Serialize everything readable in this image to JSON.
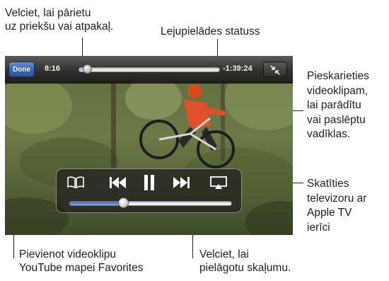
{
  "callouts": {
    "scrub": [
      "Velciet, lai pārietu",
      "uz priekšu vai atpakaļ."
    ],
    "download": "Lejupielādes statuss",
    "tap_video": [
      "Pieskarieties",
      "videoklipam,",
      "lai parādītu",
      "vai paslēptu",
      "vadīklas."
    ],
    "airplay": [
      "Skatīties",
      "televizoru ar",
      "Apple TV",
      "ierīci"
    ],
    "favorites": [
      "Pievienot videoklipu",
      "YouTube mapei Favorites"
    ],
    "volume": [
      "Velciet, lai",
      "pielāgotu skaļumu."
    ]
  },
  "player": {
    "done_label": "Done",
    "elapsed": "8:16",
    "remaining": "-1:39:24",
    "playback_progress": 0.06,
    "download_progress": 0.06,
    "volume_level": 0.33
  },
  "icons": {
    "bookmark": "book-icon",
    "previous": "skip-back-icon",
    "pause": "pause-icon",
    "next": "skip-forward-icon",
    "airplay": "airplay-icon",
    "shrink": "shrink-icon"
  },
  "colors": {
    "done_button": "#3a64b8",
    "volume_fill": "#3f6fc9",
    "callout_text": "#231f20"
  }
}
